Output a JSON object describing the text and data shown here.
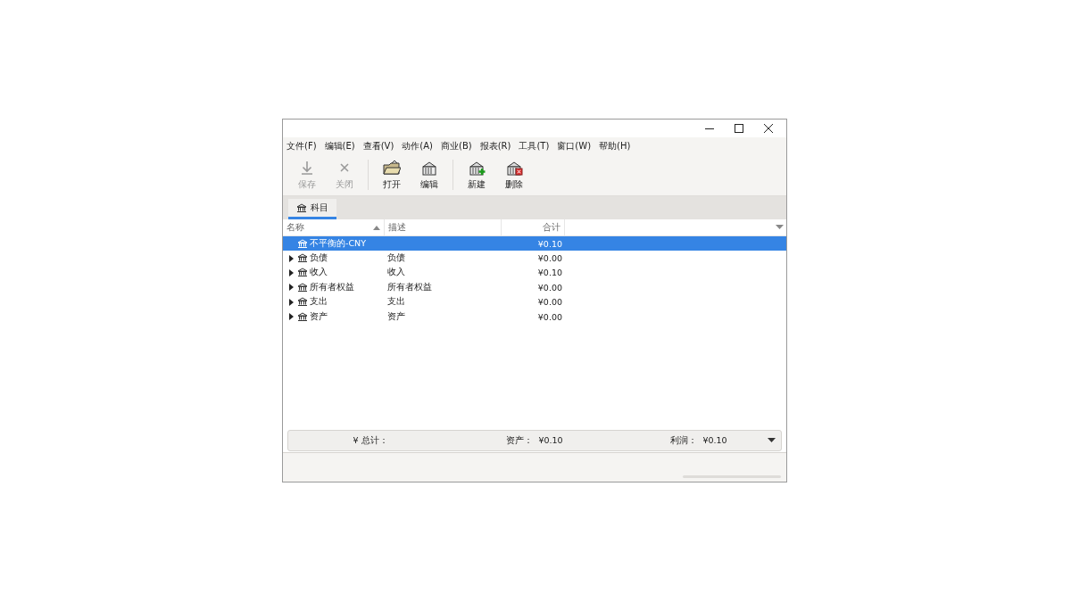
{
  "menu": [
    "文件(F)",
    "编辑(E)",
    "查看(V)",
    "动作(A)",
    "商业(B)",
    "报表(R)",
    "工具(T)",
    "窗口(W)",
    "帮助(H)"
  ],
  "toolbar": [
    {
      "kind": "save",
      "label": "保存",
      "disabled": true
    },
    {
      "kind": "close",
      "label": "关闭",
      "disabled": true
    },
    {
      "kind": "separator"
    },
    {
      "kind": "open",
      "label": "打开",
      "disabled": false
    },
    {
      "kind": "edit",
      "label": "编辑",
      "disabled": false
    },
    {
      "kind": "separator"
    },
    {
      "kind": "new",
      "label": "新建",
      "disabled": false
    },
    {
      "kind": "delete",
      "label": "删除",
      "disabled": false
    }
  ],
  "tabs": [
    {
      "label": "科目",
      "selected": true
    }
  ],
  "table": {
    "columns": [
      "名称",
      "描述",
      "合计"
    ],
    "rows": [
      {
        "kind": "leaf",
        "name": "不平衡的-CNY",
        "total": "¥0.10",
        "selected": true
      },
      {
        "kind": "group",
        "name": "负债",
        "description": "负债",
        "total": "¥0.00",
        "selected": false
      },
      {
        "kind": "group",
        "name": "收入",
        "description": "收入",
        "total": "¥0.10",
        "selected": false
      },
      {
        "kind": "group",
        "name": "所有者权益",
        "description": "所有者权益",
        "total": "¥0.00",
        "selected": false
      },
      {
        "kind": "group",
        "name": "支出",
        "description": "支出",
        "total": "¥0.00",
        "selected": false
      },
      {
        "kind": "group",
        "name": "资产",
        "description": "资产",
        "total": "¥0.00",
        "selected": false
      }
    ]
  },
  "summary": {
    "total_label": "¥ 总计：",
    "items": [
      {
        "label": "资产：",
        "value": "¥0.10"
      },
      {
        "label": "利润：",
        "value": "¥0.10"
      }
    ]
  }
}
